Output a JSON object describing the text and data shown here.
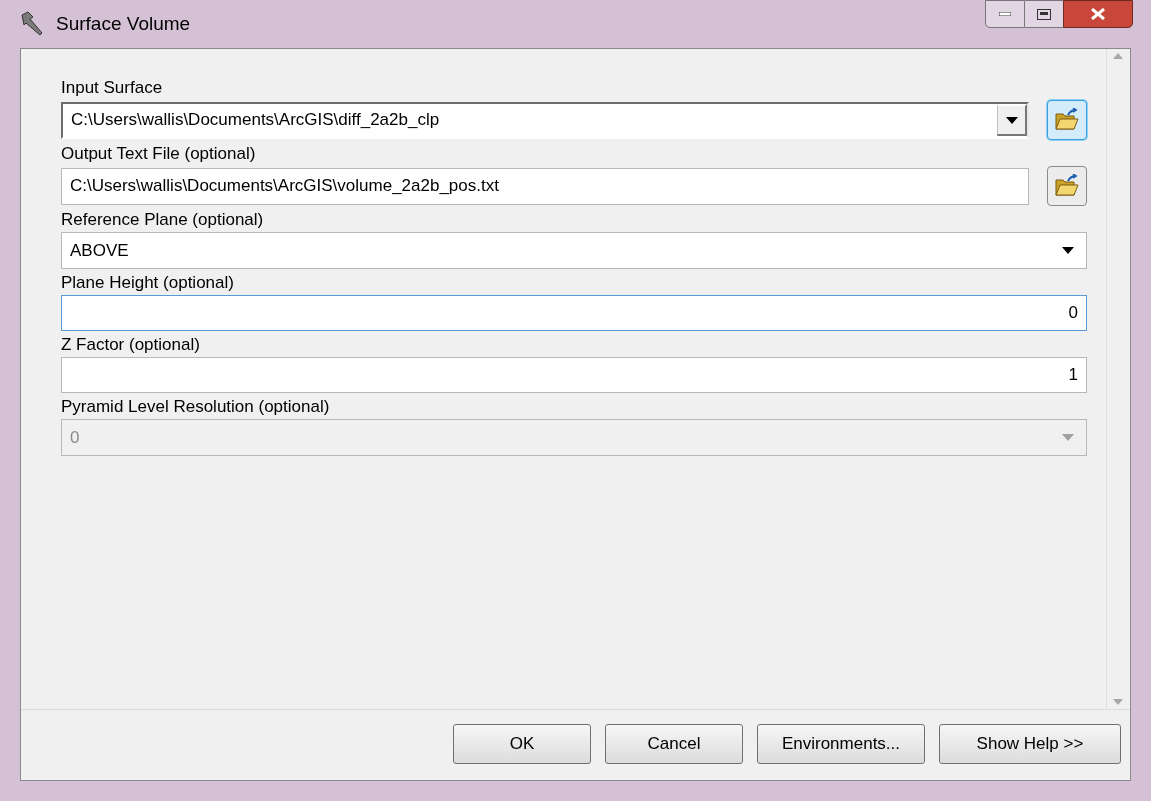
{
  "window": {
    "title": "Surface Volume"
  },
  "fields": [
    {
      "label": "Input Surface",
      "kind": "combo",
      "value": "C:\\Users\\wallis\\Documents\\ArcGIS\\diff_2a2b_clp",
      "focused": false,
      "disabled": false,
      "browse": {
        "highlighted": true
      }
    },
    {
      "label": "Output Text File (optional)",
      "kind": "text",
      "value": "C:\\Users\\wallis\\Documents\\ArcGIS\\volume_2a2b_pos.txt",
      "focused": false,
      "disabled": false,
      "browse": {
        "highlighted": false
      }
    },
    {
      "label": "Reference Plane (optional)",
      "kind": "select",
      "value": "ABOVE",
      "focused": false,
      "disabled": false
    },
    {
      "label": "Plane Height (optional)",
      "kind": "number",
      "value": "0",
      "focused": true,
      "disabled": false
    },
    {
      "label": "Z Factor (optional)",
      "kind": "number",
      "value": "1",
      "focused": false,
      "disabled": false
    },
    {
      "label": "Pyramid Level Resolution (optional)",
      "kind": "select",
      "value": "0",
      "focused": false,
      "disabled": true
    }
  ],
  "buttons": [
    "OK",
    "Cancel",
    "Environments...",
    "Show Help >>"
  ]
}
